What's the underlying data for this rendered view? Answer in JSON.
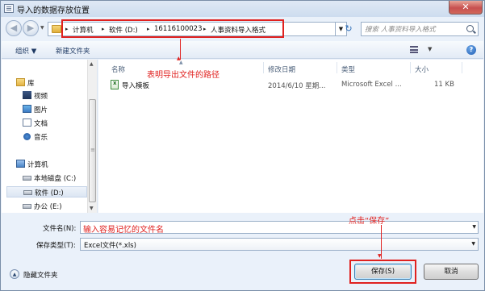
{
  "window": {
    "title": "导入的数据存放位置",
    "close_glyph": "✕"
  },
  "nav": {
    "back_glyph": "◀",
    "forward_glyph": "▶",
    "refresh_glyph": "↻"
  },
  "breadcrumbs": [
    "计算机",
    "软件 (D:)",
    "16116100023",
    "人事资料导入格式"
  ],
  "breadcrumb_separator": "▸",
  "search": {
    "placeholder": "搜索 人事资料导入格式"
  },
  "toolbar": {
    "organize_label": "组织 ▼",
    "new_folder_label": "新建文件夹"
  },
  "nav_pane": {
    "items": [
      {
        "label": "库",
        "icon": "library-icon"
      },
      {
        "label": "视频",
        "icon": "video-icon"
      },
      {
        "label": "图片",
        "icon": "pictures-icon"
      },
      {
        "label": "文档",
        "icon": "documents-icon"
      },
      {
        "label": "音乐",
        "icon": "music-icon"
      },
      {
        "label": "计算机",
        "icon": "computer-icon"
      },
      {
        "label": "本地磁盘 (C:)",
        "icon": "drive-icon"
      },
      {
        "label": "软件 (D:)",
        "icon": "drive-icon",
        "selected": true
      },
      {
        "label": "办公 (E:)",
        "icon": "drive-icon"
      }
    ]
  },
  "columns": [
    "名称",
    "修改日期",
    "类型",
    "大小"
  ],
  "files": [
    {
      "name": "导入模板",
      "modified": "2014/6/10 星期...",
      "type": "Microsoft Excel ...",
      "size": "11 KB"
    }
  ],
  "form": {
    "filename_label": "文件名(N):",
    "filetype_label": "保存类型(T):",
    "filetype_value": "Excel文件(*.xls)"
  },
  "footer": {
    "hide_folders_label": "隐藏文件夹",
    "save_label": "保存(S)",
    "cancel_label": "取消"
  },
  "annotations": {
    "path_note": "表明导出文件的路径",
    "filename_note": "输入容易记忆的文件名",
    "save_note": "点击“保存”"
  },
  "colors": {
    "annotation": "#e0211f",
    "title_bar": "#dfe9f5",
    "close_button": "#c75050"
  }
}
